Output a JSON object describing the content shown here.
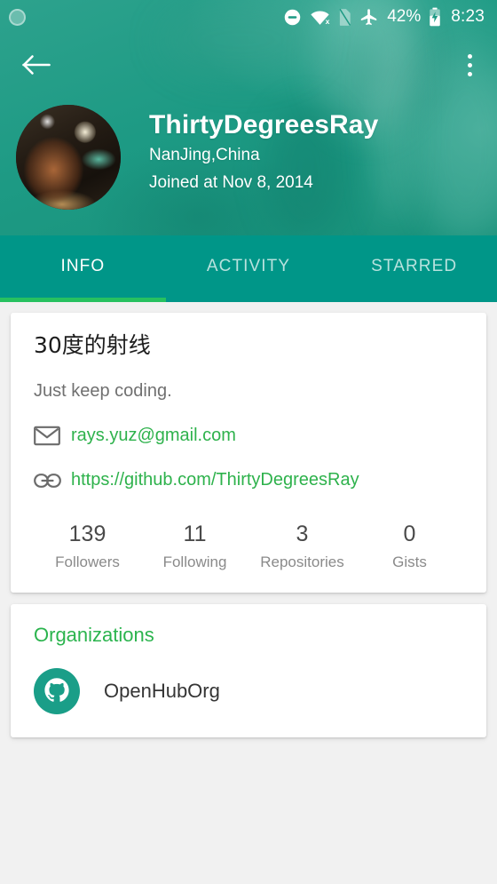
{
  "status_bar": {
    "time": "8:23",
    "battery_percent": "42%",
    "icons": [
      "notification-circle-icon",
      "do-not-disturb-icon",
      "wifi-off-icon",
      "sim-card-missing-icon",
      "airplane-mode-icon",
      "battery-charging-icon"
    ]
  },
  "action_bar": {
    "back_icon": "back-arrow-icon",
    "overflow_icon": "overflow-menu-icon"
  },
  "profile": {
    "username": "ThirtyDegreesRay",
    "location": "NanJing,China",
    "joined": "Joined at Nov 8, 2014",
    "avatar_icon": "user-avatar-photo"
  },
  "tabs": [
    {
      "label": "INFO",
      "active": true
    },
    {
      "label": "ACTIVITY",
      "active": false
    },
    {
      "label": "STARRED",
      "active": false
    }
  ],
  "info_card": {
    "display_name": "30度的射线",
    "bio": "Just keep coding.",
    "email": {
      "icon": "email-icon",
      "value": "rays.yuz@gmail.com"
    },
    "website": {
      "icon": "link-icon",
      "value": "https://github.com/ThirtyDegreesRay"
    },
    "stats": [
      {
        "value": "139",
        "label": "Followers"
      },
      {
        "value": "11",
        "label": "Following"
      },
      {
        "value": "3",
        "label": "Repositories"
      },
      {
        "value": "0",
        "label": "Gists"
      }
    ]
  },
  "organizations_card": {
    "title": "Organizations",
    "items": [
      {
        "name": "OpenHubOrg",
        "icon": "github-octocat-icon"
      }
    ]
  },
  "colors": {
    "header_teal": "#1d9a84",
    "tab_bar_teal": "#009688",
    "accent_green": "#27c160",
    "link_green": "#2eb24c",
    "page_background": "#f1f1f1",
    "card_white": "#ffffff"
  }
}
